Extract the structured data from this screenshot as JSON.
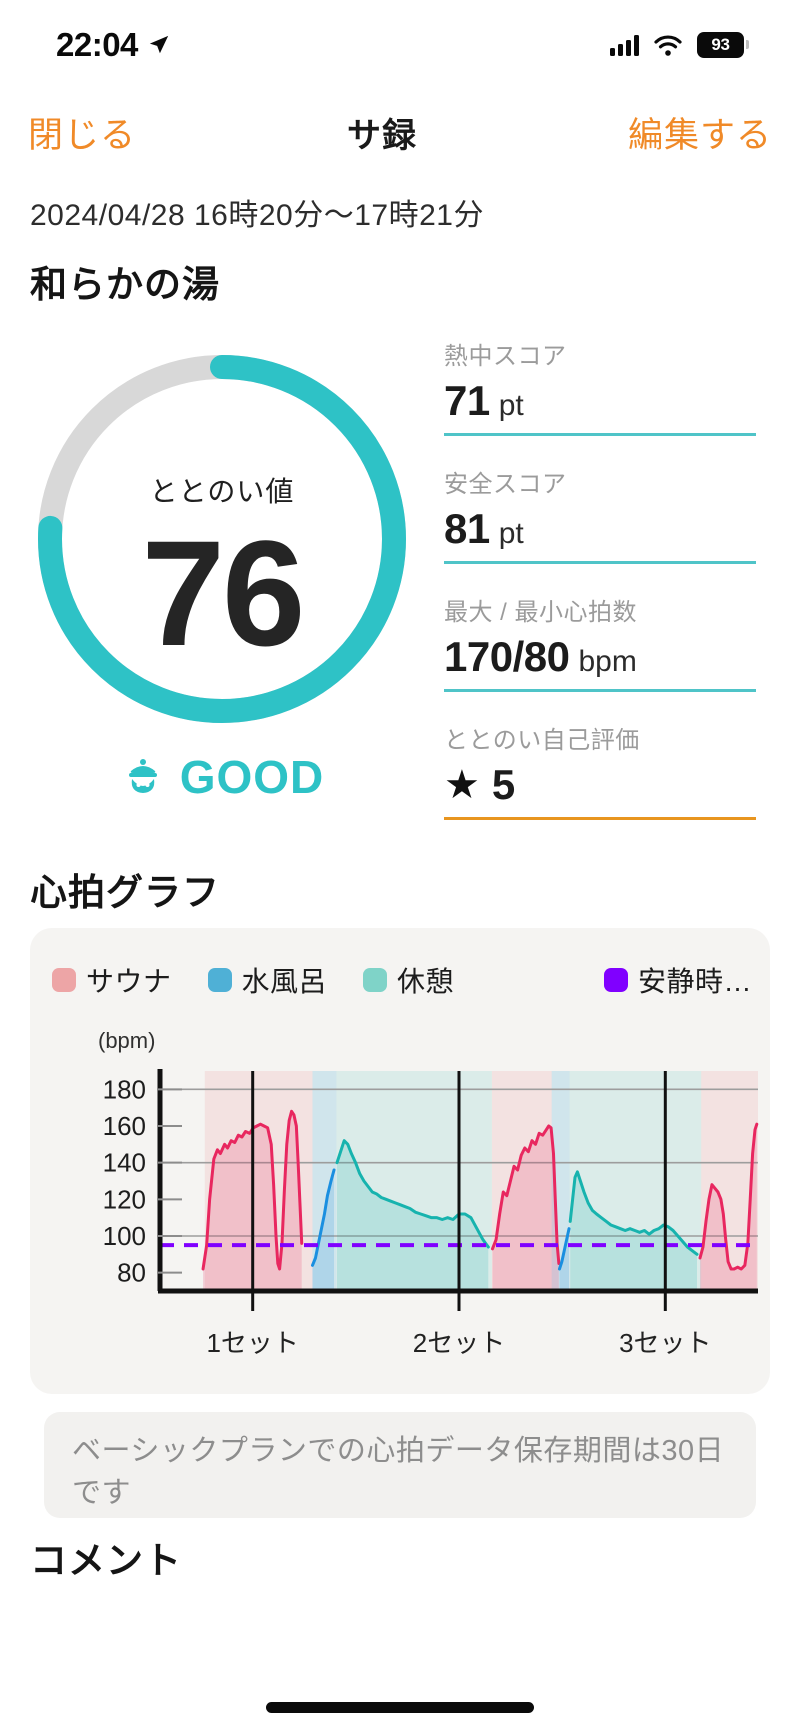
{
  "status_bar": {
    "time": "22:04",
    "location_icon": "location-arrow-icon",
    "signal_icon": "cellular-signal-icon",
    "wifi_icon": "wifi-icon",
    "battery_level": "93"
  },
  "nav": {
    "close_label": "閉じる",
    "title": "サ録",
    "edit_label": "編集する"
  },
  "header": {
    "date_range": "2024/04/28 16時20分〜17時21分",
    "facility_name": "和らかの湯"
  },
  "score": {
    "gauge_label": "ととのい値",
    "gauge_value": "76",
    "gauge_percent": 76,
    "gauge_track_color": "#d8d8d8",
    "gauge_fill_color": "#2ec2c6",
    "verdict_text": "GOOD",
    "verdict_icon": "sauna-hat-face-icon",
    "verdict_color": "#2ec2c6"
  },
  "stats": [
    {
      "label": "熱中スコア",
      "value": "71",
      "unit": "pt",
      "rule_color": "#4fc4c8"
    },
    {
      "label": "安全スコア",
      "value": "81",
      "unit": "pt",
      "rule_color": "#4fc4c8"
    },
    {
      "label": "最大 / 最小心拍数",
      "value": "170/80",
      "unit": "bpm",
      "rule_color": "#4fc4c8"
    },
    {
      "label": "ととのい自己評価",
      "value": "5",
      "unit": "",
      "star": "★",
      "rule_color": "#e8951f"
    }
  ],
  "chart_section": {
    "title": "心拍グラフ"
  },
  "notice": {
    "text": "ベーシックプランでの心拍データ保存期間は30日です"
  },
  "comment_section": {
    "title": "コメント"
  },
  "chart_data": {
    "type": "line",
    "title": "心拍グラフ",
    "ylabel": "(bpm)",
    "xlabel": "",
    "ylim": [
      70,
      190
    ],
    "yticks": [
      180,
      160,
      140,
      120,
      100,
      80
    ],
    "gridlines": [
      180,
      140,
      100
    ],
    "grid": true,
    "legend_position": "top",
    "legend": [
      {
        "name": "サウナ",
        "color": "#eda5a6"
      },
      {
        "name": "水風呂",
        "color": "#4fb0d6"
      },
      {
        "name": "休憩",
        "color": "#7fd3c8"
      },
      {
        "name": "安静時…",
        "color": "#8000ff"
      }
    ],
    "resting_hr": 95,
    "x_tick_labels": [
      "1セット",
      "2セット",
      "3セット"
    ],
    "x_tick_positions": [
      0.155,
      0.5,
      0.845
    ],
    "phases": [
      {
        "type": "サウナ",
        "x0": 0.075,
        "x1": 0.255,
        "color": "#eda5a6"
      },
      {
        "type": "水風呂",
        "x0": 0.255,
        "x1": 0.295,
        "color": "#4fb0d6"
      },
      {
        "type": "休憩",
        "x0": 0.295,
        "x1": 0.555,
        "color": "#7fd3c8"
      },
      {
        "type": "サウナ",
        "x0": 0.555,
        "x1": 0.655,
        "color": "#eda5a6"
      },
      {
        "type": "水風呂",
        "x0": 0.655,
        "x1": 0.685,
        "color": "#4fb0d6"
      },
      {
        "type": "休憩",
        "x0": 0.685,
        "x1": 0.905,
        "color": "#7fd3c8"
      },
      {
        "type": "サウナ",
        "x0": 0.905,
        "x1": 1.0,
        "color": "#eda5a6"
      }
    ],
    "series": [
      {
        "name": "サウナ",
        "color": "#e8275f",
        "points": [
          [
            0.072,
            82
          ],
          [
            0.078,
            95
          ],
          [
            0.083,
            120
          ],
          [
            0.09,
            142
          ],
          [
            0.096,
            147
          ],
          [
            0.101,
            145
          ],
          [
            0.108,
            150
          ],
          [
            0.113,
            148
          ],
          [
            0.119,
            152
          ],
          [
            0.125,
            151
          ],
          [
            0.131,
            155
          ],
          [
            0.137,
            154
          ],
          [
            0.143,
            157
          ],
          [
            0.15,
            156
          ],
          [
            0.156,
            159
          ],
          [
            0.162,
            160
          ],
          [
            0.168,
            161
          ],
          [
            0.174,
            160
          ],
          [
            0.18,
            159
          ],
          [
            0.186,
            150
          ],
          [
            0.19,
            128
          ],
          [
            0.194,
            100
          ],
          [
            0.197,
            85
          ],
          [
            0.2,
            82
          ],
          [
            0.204,
            96
          ],
          [
            0.208,
            125
          ],
          [
            0.212,
            150
          ],
          [
            0.216,
            163
          ],
          [
            0.22,
            168
          ],
          [
            0.224,
            166
          ],
          [
            0.228,
            160
          ],
          [
            0.231,
            140
          ],
          [
            0.234,
            118
          ],
          [
            0.237,
            96
          ]
        ]
      },
      {
        "name": "水風呂",
        "color": "#1a8fe0",
        "points": [
          [
            0.255,
            84
          ],
          [
            0.26,
            88
          ],
          [
            0.265,
            96
          ],
          [
            0.27,
            104
          ],
          [
            0.275,
            112
          ],
          [
            0.28,
            122
          ],
          [
            0.286,
            130
          ],
          [
            0.291,
            136
          ]
        ]
      },
      {
        "name": "休憩",
        "color": "#17b3ae",
        "points": [
          [
            0.296,
            140
          ],
          [
            0.302,
            146
          ],
          [
            0.308,
            152
          ],
          [
            0.314,
            150
          ],
          [
            0.32,
            145
          ],
          [
            0.327,
            140
          ],
          [
            0.334,
            134
          ],
          [
            0.341,
            130
          ],
          [
            0.348,
            127
          ],
          [
            0.355,
            124
          ],
          [
            0.362,
            123
          ],
          [
            0.37,
            121
          ],
          [
            0.378,
            120
          ],
          [
            0.386,
            119
          ],
          [
            0.394,
            118
          ],
          [
            0.402,
            117
          ],
          [
            0.41,
            116
          ],
          [
            0.418,
            115
          ],
          [
            0.427,
            113
          ],
          [
            0.436,
            112
          ],
          [
            0.445,
            111
          ],
          [
            0.454,
            110
          ],
          [
            0.463,
            110
          ],
          [
            0.472,
            109
          ],
          [
            0.481,
            110
          ],
          [
            0.49,
            109
          ],
          [
            0.5,
            112
          ],
          [
            0.51,
            112
          ],
          [
            0.52,
            110
          ],
          [
            0.53,
            104
          ],
          [
            0.54,
            98
          ],
          [
            0.549,
            94
          ]
        ]
      },
      {
        "name": "サウナ",
        "color": "#e8275f",
        "points": [
          [
            0.556,
            93
          ],
          [
            0.562,
            98
          ],
          [
            0.568,
            112
          ],
          [
            0.574,
            124
          ],
          [
            0.58,
            122
          ],
          [
            0.586,
            130
          ],
          [
            0.592,
            138
          ],
          [
            0.598,
            136
          ],
          [
            0.604,
            144
          ],
          [
            0.61,
            148
          ],
          [
            0.616,
            146
          ],
          [
            0.622,
            152
          ],
          [
            0.628,
            150
          ],
          [
            0.634,
            156
          ],
          [
            0.64,
            155
          ],
          [
            0.646,
            158
          ],
          [
            0.65,
            160
          ],
          [
            0.654,
            159
          ],
          [
            0.658,
            145
          ],
          [
            0.661,
            120
          ],
          [
            0.664,
            96
          ],
          [
            0.667,
            85
          ]
        ]
      },
      {
        "name": "水風呂",
        "color": "#1a8fe0",
        "points": [
          [
            0.668,
            82
          ],
          [
            0.672,
            86
          ],
          [
            0.676,
            92
          ],
          [
            0.68,
            98
          ],
          [
            0.684,
            104
          ]
        ]
      },
      {
        "name": "休憩",
        "color": "#17b3ae",
        "points": [
          [
            0.686,
            108
          ],
          [
            0.69,
            120
          ],
          [
            0.694,
            132
          ],
          [
            0.698,
            135
          ],
          [
            0.703,
            130
          ],
          [
            0.709,
            124
          ],
          [
            0.716,
            118
          ],
          [
            0.723,
            114
          ],
          [
            0.73,
            112
          ],
          [
            0.738,
            110
          ],
          [
            0.746,
            108
          ],
          [
            0.754,
            106
          ],
          [
            0.762,
            105
          ],
          [
            0.77,
            104
          ],
          [
            0.778,
            103
          ],
          [
            0.786,
            104
          ],
          [
            0.794,
            103
          ],
          [
            0.802,
            102
          ],
          [
            0.81,
            103
          ],
          [
            0.818,
            101
          ],
          [
            0.826,
            103
          ],
          [
            0.834,
            104
          ],
          [
            0.842,
            106
          ],
          [
            0.85,
            105
          ],
          [
            0.858,
            103
          ],
          [
            0.866,
            100
          ],
          [
            0.874,
            97
          ],
          [
            0.882,
            94
          ],
          [
            0.89,
            92
          ],
          [
            0.898,
            90
          ]
        ]
      },
      {
        "name": "サウナ",
        "color": "#e8275f",
        "points": [
          [
            0.903,
            88
          ],
          [
            0.908,
            94
          ],
          [
            0.913,
            108
          ],
          [
            0.918,
            120
          ],
          [
            0.923,
            128
          ],
          [
            0.928,
            126
          ],
          [
            0.933,
            124
          ],
          [
            0.938,
            120
          ],
          [
            0.942,
            112
          ],
          [
            0.946,
            98
          ],
          [
            0.95,
            86
          ],
          [
            0.955,
            82
          ],
          [
            0.96,
            82
          ],
          [
            0.966,
            83
          ],
          [
            0.972,
            82
          ],
          [
            0.978,
            84
          ],
          [
            0.983,
            96
          ],
          [
            0.987,
            120
          ],
          [
            0.991,
            145
          ],
          [
            0.995,
            158
          ],
          [
            0.998,
            161
          ]
        ]
      }
    ]
  }
}
